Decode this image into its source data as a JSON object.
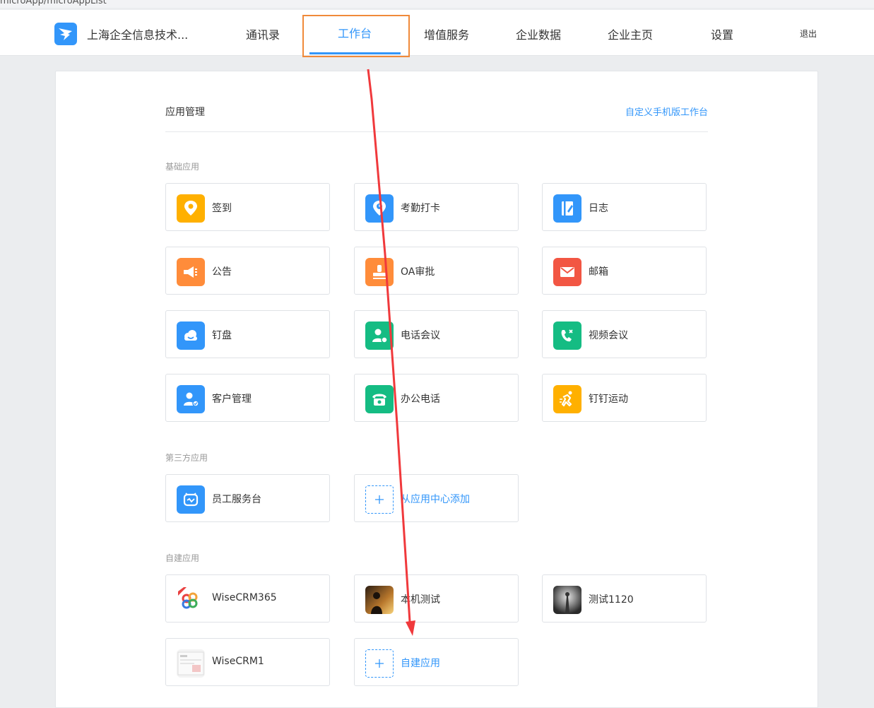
{
  "url_fragment": "microApp/microAppList",
  "header": {
    "company": "上海企全信息技术...",
    "nav": [
      "通讯录",
      "工作台",
      "增值服务",
      "企业数据",
      "企业主页",
      "设置"
    ],
    "active_index": 1,
    "logout": "退出"
  },
  "panel": {
    "title": "应用管理",
    "customize_link": "自定义手机版工作台"
  },
  "sections": {
    "basic": {
      "title": "基础应用",
      "apps": [
        {
          "label": "签到",
          "icon": "checkin-icon",
          "color": "#ffb000"
        },
        {
          "label": "考勤打卡",
          "icon": "attendance-icon",
          "color": "#3296fa"
        },
        {
          "label": "日志",
          "icon": "log-icon",
          "color": "#3296fa"
        },
        {
          "label": "公告",
          "icon": "announcement-icon",
          "color": "#ff8c3a"
        },
        {
          "label": "OA审批",
          "icon": "approval-icon",
          "color": "#ff8c3a"
        },
        {
          "label": "邮箱",
          "icon": "mail-icon",
          "color": "#f25643"
        },
        {
          "label": "钉盘",
          "icon": "cloud-drive-icon",
          "color": "#3296fa"
        },
        {
          "label": "电话会议",
          "icon": "phone-conference-icon",
          "color": "#15bc83"
        },
        {
          "label": "视频会议",
          "icon": "video-conference-icon",
          "color": "#15bc83"
        },
        {
          "label": "客户管理",
          "icon": "customer-icon",
          "color": "#3296fa"
        },
        {
          "label": "办公电话",
          "icon": "office-phone-icon",
          "color": "#15bc83"
        },
        {
          "label": "钉钉运动",
          "icon": "sport-icon",
          "color": "#ffb000"
        }
      ]
    },
    "third_party": {
      "title": "第三方应用",
      "apps": [
        {
          "label": "员工服务台",
          "icon": "service-desk-icon",
          "color": "#3296fa"
        }
      ],
      "add_label": "从应用中心添加"
    },
    "custom": {
      "title": "自建应用",
      "apps": [
        {
          "label": "WiseCRM365",
          "icon": "wisecrm-logo-icon"
        },
        {
          "label": "本机测试",
          "icon": "photo-thumbnail-icon"
        },
        {
          "label": "测试1120",
          "icon": "photo-thumbnail-icon"
        },
        {
          "label": "WiseCRM1",
          "icon": "screenshot-thumbnail-icon"
        }
      ],
      "add_label": "自建应用"
    }
  },
  "annotations": {
    "highlight_color": "#f08a3a",
    "arrow_color": "#f0393c"
  }
}
